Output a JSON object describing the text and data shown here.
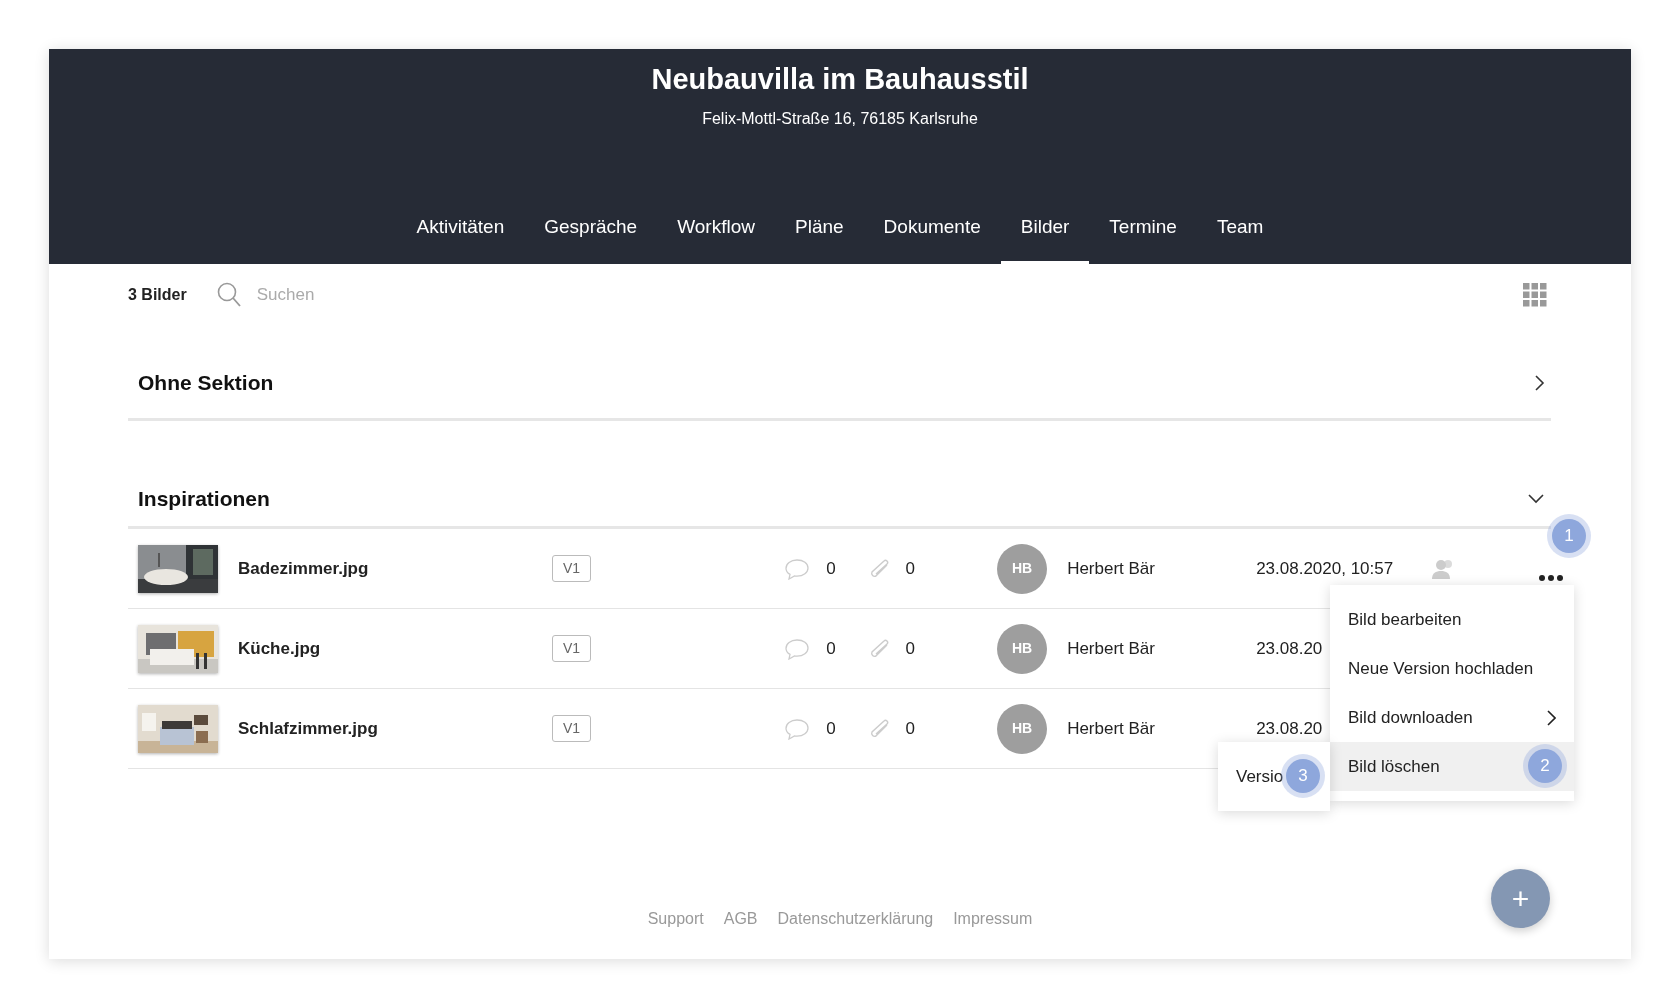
{
  "header": {
    "title": "Neubauvilla im Bauhausstil",
    "address": "Felix-Mottl-Straße 16, 76185 Karlsruhe"
  },
  "tabs": [
    {
      "label": "Aktivitäten",
      "selected": false
    },
    {
      "label": "Gespräche",
      "selected": false
    },
    {
      "label": "Workflow",
      "selected": false
    },
    {
      "label": "Pläne",
      "selected": false
    },
    {
      "label": "Dokumente",
      "selected": false
    },
    {
      "label": "Bilder",
      "selected": true
    },
    {
      "label": "Termine",
      "selected": false
    },
    {
      "label": "Team",
      "selected": false
    }
  ],
  "toolbar": {
    "count": "3 Bilder",
    "search": {
      "placeholder": "Suchen"
    }
  },
  "sections": [
    {
      "title": "Ohne Sektion",
      "expanded": false
    },
    {
      "title": "Inspirationen",
      "expanded": true,
      "rows": [
        {
          "name": "Badezimmer.jpg",
          "version": "V1",
          "comments": "0",
          "attachments": "0",
          "initials": "HB",
          "author": "Herbert Bär",
          "date": "23.08.2020, 10:57",
          "shared": true
        },
        {
          "name": "Küche.jpg",
          "version": "V1",
          "comments": "0",
          "attachments": "0",
          "initials": "HB",
          "author": "Herbert Bär",
          "date": "23.08.20",
          "shared": false
        },
        {
          "name": "Schlafzimmer.jpg",
          "version": "V1",
          "comments": "0",
          "attachments": "0",
          "initials": "HB",
          "author": "Herbert Bär",
          "date": "23.08.20",
          "shared": false
        }
      ]
    }
  ],
  "menu": {
    "callout": "1",
    "items": [
      {
        "label": "Bild bearbeiten",
        "submenu": false,
        "selected": false
      },
      {
        "label": "Neue Version hochladen",
        "submenu": false,
        "selected": false
      },
      {
        "label": "Bild downloaden",
        "submenu": true,
        "selected": false
      },
      {
        "label": "Bild löschen",
        "submenu": false,
        "selected": true,
        "callout": "2"
      }
    ]
  },
  "submenu": {
    "items": [
      {
        "label": "Versio",
        "callout": "3"
      }
    ]
  },
  "fab": {
    "label": "+"
  },
  "footer": {
    "links": [
      "Support",
      "AGB",
      "Datenschutzerklärung",
      "Impressum"
    ]
  }
}
